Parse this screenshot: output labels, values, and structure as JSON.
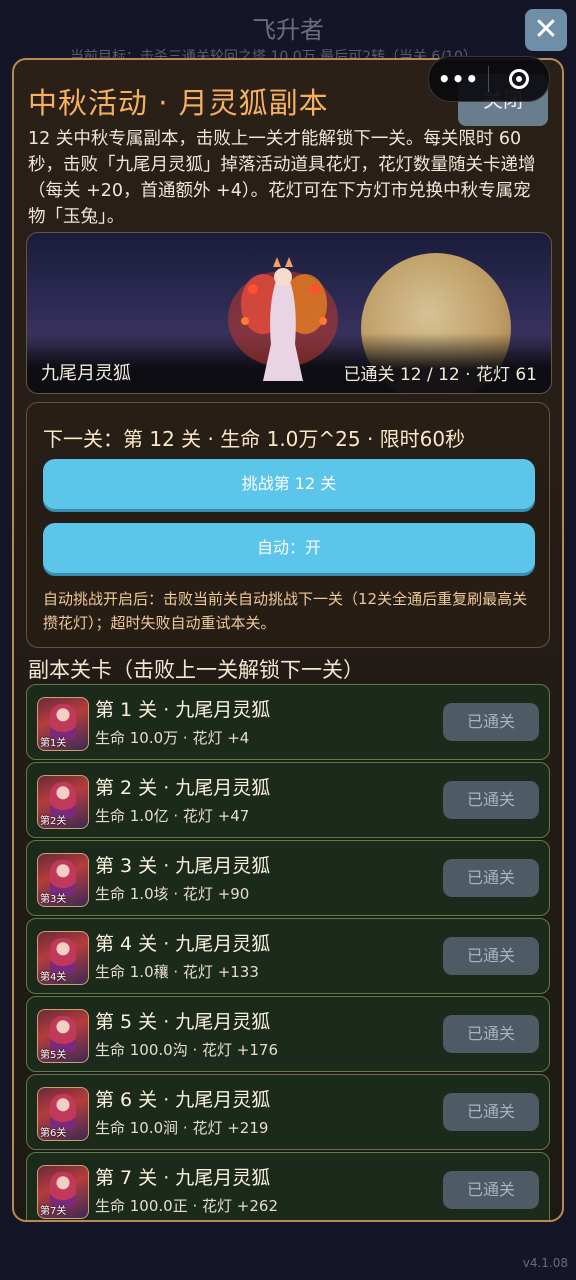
{
  "background": {
    "title": "飞升者",
    "subtitle": "当前目标：击杀三通关轮回之塔 10.0万 最后可2转（当关 6/10）"
  },
  "modal": {
    "title": "中秋活动 · 月灵狐副本",
    "close_label": "关闭",
    "description": "12 关中秋专属副本，击败上一关才能解锁下一关。每关限时 60 秒，击败「九尾月灵狐」掉落活动道具花灯，花灯数量随关卡递增（每关 +20，首通额外 +4）。花灯可在下方灯市兑换中秋专属宠物「玉兔」。"
  },
  "hero": {
    "boss_name": "九尾月灵狐",
    "stats": "已通关 12 / 12 · 花灯 61"
  },
  "next": {
    "title": "下一关：第 12 关 · 生命 1.0万^25 · 限时60秒",
    "challenge_label": "挑战第 12 关",
    "auto_label": "自动：开",
    "auto_note": "自动挑战开启后：击败当前关自动挑战下一关（12关全通后重复刷最高关攒花灯）；超时失败自动重试本关。"
  },
  "section_title": "副本关卡（击败上一关解锁下一关）",
  "stages": [
    {
      "name": "第 1 关 · 九尾月灵狐",
      "meta": "生命 10.0万 · 花灯 +4",
      "thumb_label": "第1关",
      "status": "已通关"
    },
    {
      "name": "第 2 关 · 九尾月灵狐",
      "meta": "生命 1.0亿 · 花灯 +47",
      "thumb_label": "第2关",
      "status": "已通关"
    },
    {
      "name": "第 3 关 · 九尾月灵狐",
      "meta": "生命 1.0垓 · 花灯 +90",
      "thumb_label": "第3关",
      "status": "已通关"
    },
    {
      "name": "第 4 关 · 九尾月灵狐",
      "meta": "生命 1.0穰 · 花灯 +133",
      "thumb_label": "第4关",
      "status": "已通关"
    },
    {
      "name": "第 5 关 · 九尾月灵狐",
      "meta": "生命 100.0沟 · 花灯 +176",
      "thumb_label": "第5关",
      "status": "已通关"
    },
    {
      "name": "第 6 关 · 九尾月灵狐",
      "meta": "生命 10.0涧 · 花灯 +219",
      "thumb_label": "第6关",
      "status": "已通关"
    },
    {
      "name": "第 7 关 · 九尾月灵狐",
      "meta": "生命 100.0正 · 花灯 +262",
      "thumb_label": "第7关",
      "status": "已通关"
    }
  ],
  "version": "v4.1.08",
  "colors": {
    "accent_title": "#f5b160",
    "button": "#5bc6ea",
    "status_bg": "#4e5a64",
    "panel_border": "#b58a55"
  }
}
